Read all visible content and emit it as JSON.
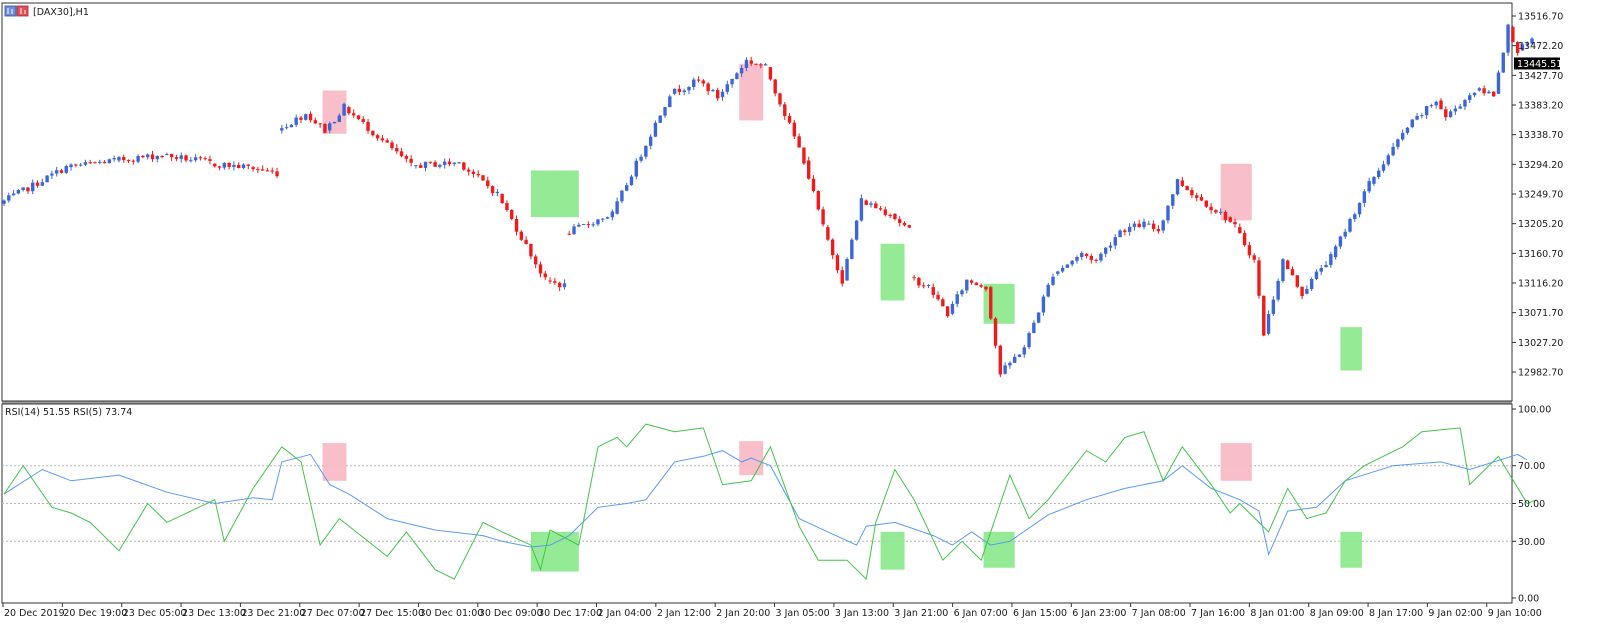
{
  "window": {
    "symbol_label": "[DAX30],H1",
    "rsi_label": "RSI(14) 51.55 RSI(5) 73.74"
  },
  "colors": {
    "bull": "#3a66d6",
    "bear": "#f01a1a",
    "rsi14": "#5a9af0",
    "rsi5": "#44c24a",
    "overbought_box": "#f7b8c4",
    "oversold_box": "#8ae88a",
    "grid_dotted": "#b8b8b8",
    "frame": "#333333"
  },
  "chart_data": [
    {
      "type": "candlestick",
      "title": "[DAX30],H1",
      "current_price": "13445.51",
      "ylim": [
        12960,
        13530
      ],
      "y_ticks": [
        "13516.70",
        "13472.20",
        "13427.70",
        "13383.20",
        "13338.70",
        "13294.20",
        "13249.70",
        "13205.20",
        "13160.70",
        "13116.20",
        "13071.70",
        "13027.20",
        "12982.70"
      ],
      "x_tick_labels": [
        "20 Dec 2019",
        "20 Dec 19:00",
        "23 Dec 05:00",
        "23 Dec 13:00",
        "23 Dec 21:00",
        "27 Dec 07:00",
        "27 Dec 15:00",
        "30 Dec 01:00",
        "30 Dec 09:00",
        "30 Dec 17:00",
        "2 Jan 04:00",
        "2 Jan 12:00",
        "2 Jan 20:00",
        "3 Jan 05:00",
        "3 Jan 13:00",
        "3 Jan 21:00",
        "6 Jan 07:00",
        "6 Jan 15:00",
        "6 Jan 23:00",
        "7 Jan 08:00",
        "7 Jan 16:00",
        "8 Jan 01:00",
        "8 Jan 09:00",
        "8 Jan 17:00",
        "9 Jan 02:00",
        "9 Jan 10:00"
      ],
      "segments": [
        {
          "open": 13235,
          "close": 13290,
          "start": 0
        },
        {
          "open": 13290,
          "close": 13300,
          "start": 14
        },
        {
          "open": 13300,
          "close": 13308,
          "start": 24
        },
        {
          "open": 13308,
          "close": 13297,
          "start": 34
        },
        {
          "open": 13295,
          "close": 13290,
          "start": 44
        },
        {
          "open": 13290,
          "close": 13281,
          "start": 52
        },
        {
          "open": 13345,
          "close": 13370,
          "start": 58
        },
        {
          "open": 13370,
          "close": 13345,
          "start": 64
        },
        {
          "open": 13345,
          "close": 13380,
          "start": 68
        },
        {
          "open": 13380,
          "close": 13292,
          "start": 72
        },
        {
          "open": 13292,
          "close": 13297,
          "start": 86
        },
        {
          "open": 13297,
          "close": 13250,
          "start": 96
        },
        {
          "open": 13250,
          "close": 13120,
          "start": 104
        },
        {
          "open": 13120,
          "close": 13112,
          "start": 114
        },
        {
          "open": 13190,
          "close": 13220,
          "start": 118
        },
        {
          "open": 13220,
          "close": 13400,
          "start": 128
        },
        {
          "open": 13400,
          "close": 13420,
          "start": 140
        },
        {
          "open": 13420,
          "close": 13395,
          "start": 146
        },
        {
          "open": 13395,
          "close": 13450,
          "start": 150
        },
        {
          "open": 13450,
          "close": 13440,
          "start": 156
        },
        {
          "open": 13440,
          "close": 13300,
          "start": 160
        },
        {
          "open": 13300,
          "close": 13200,
          "start": 168
        },
        {
          "open": 13200,
          "close": 13120,
          "start": 172
        },
        {
          "open": 13120,
          "close": 13240,
          "start": 176
        },
        {
          "open": 13240,
          "close": 13220,
          "start": 180
        },
        {
          "open": 13220,
          "close": 13195,
          "start": 186
        },
        {
          "open": 13125,
          "close": 13110,
          "start": 190
        },
        {
          "open": 13110,
          "close": 13070,
          "start": 194
        },
        {
          "open": 13070,
          "close": 13120,
          "start": 198
        },
        {
          "open": 13120,
          "close": 13110,
          "start": 202
        },
        {
          "open": 13110,
          "close": 12980,
          "start": 206
        },
        {
          "open": 12980,
          "close": 13020,
          "start": 209
        },
        {
          "open": 13020,
          "close": 13130,
          "start": 214
        },
        {
          "open": 13130,
          "close": 13160,
          "start": 220
        },
        {
          "open": 13160,
          "close": 13150,
          "start": 226
        },
        {
          "open": 13150,
          "close": 13195,
          "start": 229
        },
        {
          "open": 13195,
          "close": 13205,
          "start": 234
        },
        {
          "open": 13205,
          "close": 13195,
          "start": 239
        },
        {
          "open": 13195,
          "close": 13270,
          "start": 242
        },
        {
          "open": 13270,
          "close": 13245,
          "start": 246
        },
        {
          "open": 13245,
          "close": 13215,
          "start": 250
        },
        {
          "open": 13215,
          "close": 13200,
          "start": 256
        },
        {
          "open": 13200,
          "close": 13150,
          "start": 258
        },
        {
          "open": 13150,
          "close": 13040,
          "start": 262
        },
        {
          "open": 13040,
          "close": 13150,
          "start": 264
        },
        {
          "open": 13150,
          "close": 13100,
          "start": 268
        },
        {
          "open": 13100,
          "close": 13140,
          "start": 272
        },
        {
          "open": 13140,
          "close": 13155,
          "start": 276
        },
        {
          "open": 13155,
          "close": 13265,
          "start": 278
        },
        {
          "open": 13265,
          "close": 13350,
          "start": 286
        },
        {
          "open": 13350,
          "close": 13390,
          "start": 294
        },
        {
          "open": 13390,
          "close": 13365,
          "start": 300
        },
        {
          "open": 13365,
          "close": 13405,
          "start": 302
        },
        {
          "open": 13405,
          "close": 13400,
          "start": 308
        },
        {
          "open": 13400,
          "close": 13500,
          "start": 312
        },
        {
          "open": 13500,
          "close": 13465,
          "start": 315
        },
        {
          "open": 13465,
          "close": 13478,
          "start": 317
        }
      ]
    },
    {
      "type": "line",
      "title": "RSI(14) 51.55 RSI(5) 73.74",
      "ylim": [
        0,
        100
      ],
      "y_ticks": [
        "100.00",
        "70.00",
        "50.00",
        "30.00",
        "0.00"
      ],
      "reference_lines": [
        70,
        50,
        30
      ],
      "series": [
        {
          "name": "RSI(14)",
          "points": [
            [
              0,
              55
            ],
            [
              8,
              68
            ],
            [
              14,
              62
            ],
            [
              24,
              65
            ],
            [
              34,
              56
            ],
            [
              44,
              50
            ],
            [
              52,
              53
            ],
            [
              56,
              52
            ],
            [
              58,
              72
            ],
            [
              64,
              76
            ],
            [
              68,
              60
            ],
            [
              72,
              55
            ],
            [
              80,
              42
            ],
            [
              90,
              36
            ],
            [
              100,
              33
            ],
            [
              104,
              30
            ],
            [
              110,
              27
            ],
            [
              114,
              28
            ],
            [
              118,
              33
            ],
            [
              124,
              48
            ],
            [
              130,
              50
            ],
            [
              134,
              52
            ],
            [
              140,
              72
            ],
            [
              146,
              75
            ],
            [
              150,
              78
            ],
            [
              154,
              72
            ],
            [
              156,
              74
            ],
            [
              160,
              70
            ],
            [
              166,
              42
            ],
            [
              172,
              35
            ],
            [
              178,
              28
            ],
            [
              180,
              38
            ],
            [
              186,
              40
            ],
            [
              194,
              33
            ],
            [
              198,
              28
            ],
            [
              202,
              35
            ],
            [
              206,
              28
            ],
            [
              210,
              30
            ],
            [
              218,
              44
            ],
            [
              226,
              52
            ],
            [
              234,
              58
            ],
            [
              242,
              62
            ],
            [
              246,
              70
            ],
            [
              252,
              58
            ],
            [
              258,
              52
            ],
            [
              262,
              46
            ],
            [
              264,
              23
            ],
            [
              268,
              46
            ],
            [
              274,
              48
            ],
            [
              280,
              62
            ],
            [
              290,
              70
            ],
            [
              300,
              72
            ],
            [
              306,
              68
            ],
            [
              316,
              76
            ],
            [
              318,
              73
            ]
          ]
        },
        {
          "name": "RSI(5)",
          "points": [
            [
              0,
              55
            ],
            [
              4,
              70
            ],
            [
              10,
              48
            ],
            [
              14,
              45
            ],
            [
              18,
              40
            ],
            [
              24,
              25
            ],
            [
              30,
              50
            ],
            [
              34,
              40
            ],
            [
              44,
              52
            ],
            [
              46,
              30
            ],
            [
              52,
              58
            ],
            [
              58,
              80
            ],
            [
              62,
              72
            ],
            [
              66,
              28
            ],
            [
              70,
              42
            ],
            [
              80,
              22
            ],
            [
              84,
              35
            ],
            [
              90,
              15
            ],
            [
              94,
              10
            ],
            [
              100,
              40
            ],
            [
              104,
              35
            ],
            [
              110,
              28
            ],
            [
              112,
              15
            ],
            [
              114,
              36
            ],
            [
              120,
              28
            ],
            [
              124,
              80
            ],
            [
              128,
              85
            ],
            [
              130,
              80
            ],
            [
              134,
              92
            ],
            [
              140,
              88
            ],
            [
              146,
              90
            ],
            [
              150,
              60
            ],
            [
              156,
              62
            ],
            [
              160,
              80
            ],
            [
              166,
              38
            ],
            [
              170,
              20
            ],
            [
              176,
              20
            ],
            [
              180,
              10
            ],
            [
              182,
              40
            ],
            [
              186,
              68
            ],
            [
              190,
              52
            ],
            [
              196,
              20
            ],
            [
              200,
              30
            ],
            [
              204,
              20
            ],
            [
              210,
              65
            ],
            [
              214,
              42
            ],
            [
              218,
              52
            ],
            [
              226,
              78
            ],
            [
              230,
              72
            ],
            [
              234,
              85
            ],
            [
              238,
              88
            ],
            [
              242,
              62
            ],
            [
              246,
              80
            ],
            [
              252,
              60
            ],
            [
              256,
              45
            ],
            [
              258,
              50
            ],
            [
              264,
              35
            ],
            [
              268,
              58
            ],
            [
              272,
              42
            ],
            [
              276,
              45
            ],
            [
              280,
              62
            ],
            [
              284,
              70
            ],
            [
              292,
              80
            ],
            [
              296,
              88
            ],
            [
              304,
              90
            ],
            [
              306,
              60
            ],
            [
              312,
              75
            ],
            [
              318,
              50
            ],
            [
              320,
              52
            ]
          ]
        }
      ]
    }
  ],
  "highlight_boxes": [
    {
      "kind": "overbought",
      "bar_start": 66.5,
      "bar_end": 71.5,
      "price_top": 13405,
      "price_bottom": 13340,
      "rsi_top": 82,
      "rsi_bottom": 62
    },
    {
      "kind": "oversold",
      "bar_start": 110,
      "bar_end": 120,
      "price_top": 13285,
      "price_bottom": 13215,
      "rsi_top": 35,
      "rsi_bottom": 14
    },
    {
      "kind": "overbought",
      "bar_start": 153.5,
      "bar_end": 158.5,
      "price_top": 13445,
      "price_bottom": 13360,
      "rsi_top": 83,
      "rsi_bottom": 65
    },
    {
      "kind": "oversold",
      "bar_start": 183,
      "bar_end": 188,
      "price_top": 13175,
      "price_bottom": 13090,
      "rsi_top": 35,
      "rsi_bottom": 15
    },
    {
      "kind": "oversold",
      "bar_start": 204.5,
      "bar_end": 211,
      "price_top": 13115,
      "price_bottom": 13055,
      "rsi_top": 35,
      "rsi_bottom": 16
    },
    {
      "kind": "overbought",
      "bar_start": 254,
      "bar_end": 260.5,
      "price_top": 13295,
      "price_bottom": 13210,
      "rsi_top": 82,
      "rsi_bottom": 62
    },
    {
      "kind": "oversold",
      "bar_start": 279,
      "bar_end": 283.5,
      "price_top": 13050,
      "price_bottom": 12985,
      "rsi_top": 35,
      "rsi_bottom": 16
    }
  ]
}
